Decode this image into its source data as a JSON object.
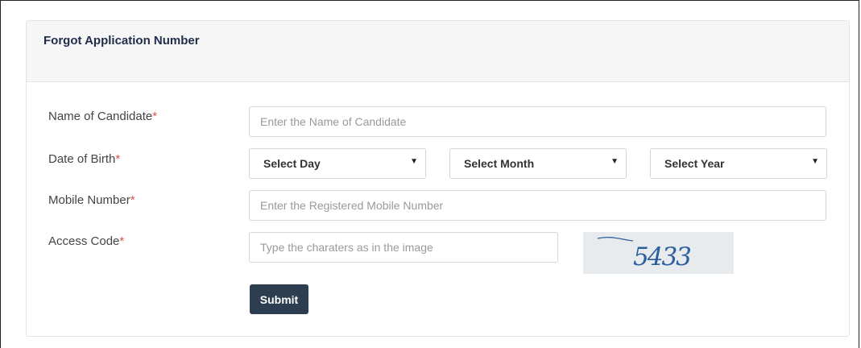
{
  "form": {
    "title": "Forgot Application Number",
    "required_marker": "*",
    "name": {
      "label": "Name of Candidate",
      "placeholder": "Enter the Name of Candidate",
      "value": ""
    },
    "dob": {
      "label": "Date of Birth",
      "day": "Select Day",
      "month": "Select Month",
      "year": "Select Year"
    },
    "mobile": {
      "label": "Mobile Number",
      "placeholder": "Enter the Registered Mobile Number",
      "value": ""
    },
    "access_code": {
      "label": "Access Code",
      "placeholder": "Type the charaters as in the image",
      "captcha_text": "5433"
    },
    "submit_label": "Submit"
  },
  "colors": {
    "header_bg": "#f6f6f6",
    "title": "#1f2d4a",
    "required": "#d9534f",
    "button_bg": "#2c3e50",
    "captcha_bg": "#e8ebee",
    "captcha_ink": "#2b5f9e"
  }
}
